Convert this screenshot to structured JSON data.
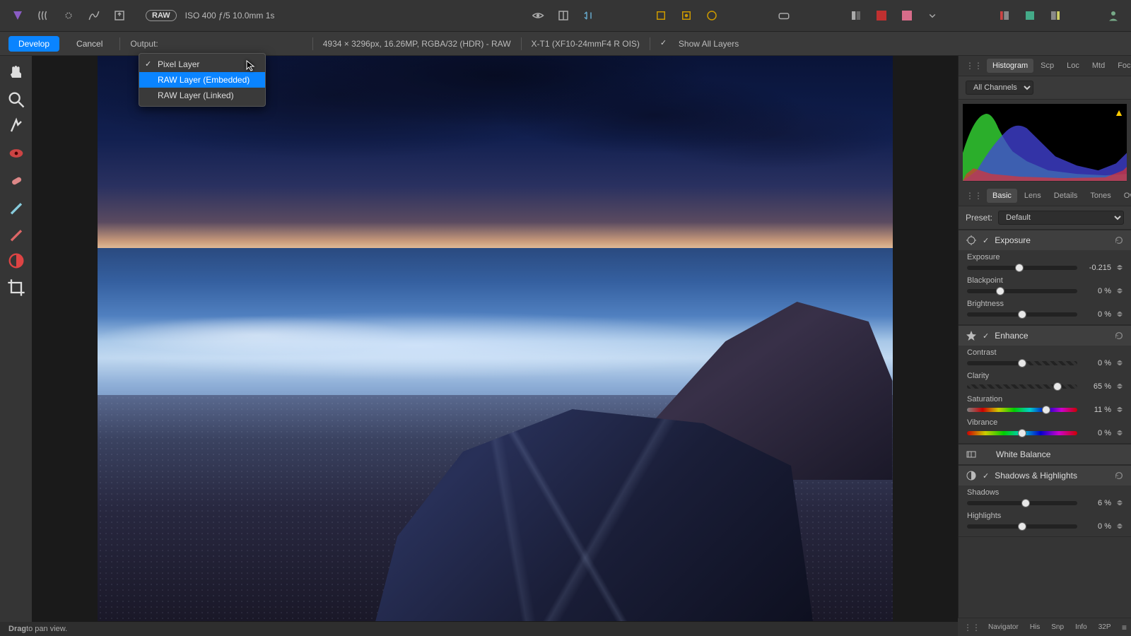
{
  "topbar": {
    "raw_badge": "RAW",
    "meta": "ISO 400 ƒ/5 10.0mm 1s"
  },
  "secondbar": {
    "develop": "Develop",
    "cancel": "Cancel",
    "output_label": "Output:",
    "image_info": "4934 × 3296px, 16.26MP, RGBA/32 (HDR) - RAW",
    "camera_info": "X-T1 (XF10-24mmF4 R OIS)",
    "show_all": "Show All Layers"
  },
  "dropdown": {
    "items": [
      {
        "label": "Pixel Layer",
        "checked": true,
        "highlight": false
      },
      {
        "label": "RAW Layer (Embedded)",
        "checked": false,
        "highlight": true
      },
      {
        "label": "RAW Layer (Linked)",
        "checked": false,
        "highlight": false
      }
    ]
  },
  "right": {
    "tabs1": [
      "Histogram",
      "Scp",
      "Loc",
      "Mtd",
      "Focus"
    ],
    "channels": "All Channels",
    "tabs2": [
      "Basic",
      "Lens",
      "Details",
      "Tones",
      "Overlays"
    ],
    "preset_label": "Preset:",
    "preset_value": "Default",
    "exposure_section": "Exposure",
    "exposure": {
      "label": "Exposure",
      "value": "-0.215",
      "pos": 47.5
    },
    "blackpoint": {
      "label": "Blackpoint",
      "value": "0 %",
      "pos": 30
    },
    "brightness": {
      "label": "Brightness",
      "value": "0 %",
      "pos": 50
    },
    "enhance_section": "Enhance",
    "contrast": {
      "label": "Contrast",
      "value": "0 %",
      "pos": 50
    },
    "clarity": {
      "label": "Clarity",
      "value": "65 %",
      "pos": 82
    },
    "saturation": {
      "label": "Saturation",
      "value": "11 %",
      "pos": 72
    },
    "vibrance": {
      "label": "Vibrance",
      "value": "0 %",
      "pos": 50
    },
    "wb_section": "White Balance",
    "sh_section": "Shadows & Highlights",
    "shadows": {
      "label": "Shadows",
      "value": "6 %",
      "pos": 53
    },
    "highlights": {
      "label": "Highlights",
      "value": "0 %",
      "pos": 50
    }
  },
  "bottom": {
    "hint_strong": "Drag",
    "hint_rest": " to pan view.",
    "tabs": [
      "Navigator",
      "His",
      "Snp",
      "Info",
      "32P"
    ]
  }
}
